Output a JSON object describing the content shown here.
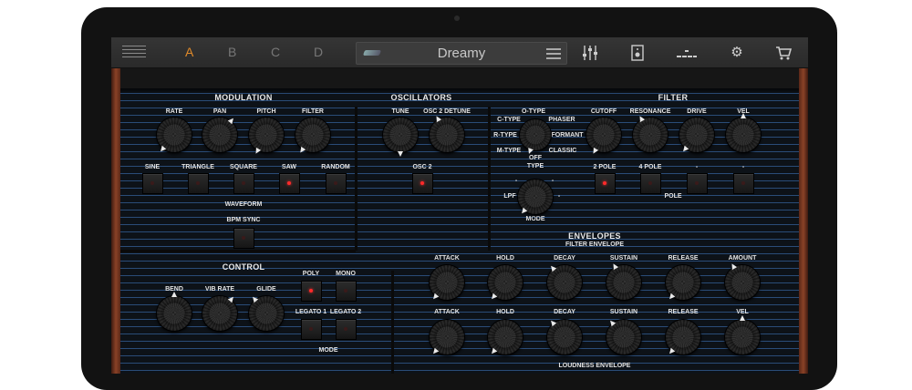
{
  "topbar": {
    "presets": [
      "A",
      "B",
      "C",
      "D"
    ],
    "active_preset": "A",
    "preset_name": "Dreamy"
  },
  "modulation": {
    "title": "MODULATION",
    "knobs": [
      "RATE",
      "PAN",
      "PITCH",
      "FILTER"
    ],
    "waveforms": [
      "SINE",
      "TRIANGLE",
      "SQUARE",
      "SAW",
      "RANDOM"
    ],
    "waveform_label": "WAVEFORM",
    "bpm_sync": "BPM SYNC"
  },
  "oscillators": {
    "title": "OSCILLATORS",
    "knobs": [
      "TUNE",
      "OSC 2 DETUNE"
    ],
    "osc2": "OSC 2"
  },
  "filter": {
    "title": "FILTER",
    "type_options": [
      "O-TYPE",
      "C-TYPE",
      "PHASER",
      "R-TYPE",
      "FORMANT",
      "M-TYPE",
      "CLASSIC",
      "OFF"
    ],
    "type_label": "TYPE",
    "knobs": [
      "CUTOFF",
      "RESONANCE",
      "DRIVE",
      "VEL"
    ],
    "mode_options": [
      "LPF",
      "-",
      "-",
      "-"
    ],
    "mode_label": "MODE",
    "pole_buttons": [
      "2 POLE",
      "4 POLE",
      "-",
      "-"
    ],
    "pole_label": "POLE"
  },
  "envelopes": {
    "title": "ENVELOPES",
    "filter_env_label": "FILTER ENVELOPE",
    "filter_knobs": [
      "ATTACK",
      "HOLD",
      "DECAY",
      "SUSTAIN",
      "RELEASE",
      "AMOUNT"
    ],
    "loudness_knobs": [
      "ATTACK",
      "HOLD",
      "DECAY",
      "SUSTAIN",
      "RELEASE",
      "VEL"
    ],
    "loudness_env_label": "LOUDNESS ENVELOPE"
  },
  "control": {
    "title": "CONTROL",
    "knobs": [
      "BEND",
      "VIB RATE",
      "GLIDE"
    ],
    "mode_buttons": [
      "POLY",
      "MONO",
      "LEGATO 1",
      "LEGATO 2"
    ],
    "mode_label": "MODE"
  },
  "colors": {
    "accent": "#e08a2a",
    "led_on": "#ff2a2a",
    "stripe": "#2a4c78"
  }
}
